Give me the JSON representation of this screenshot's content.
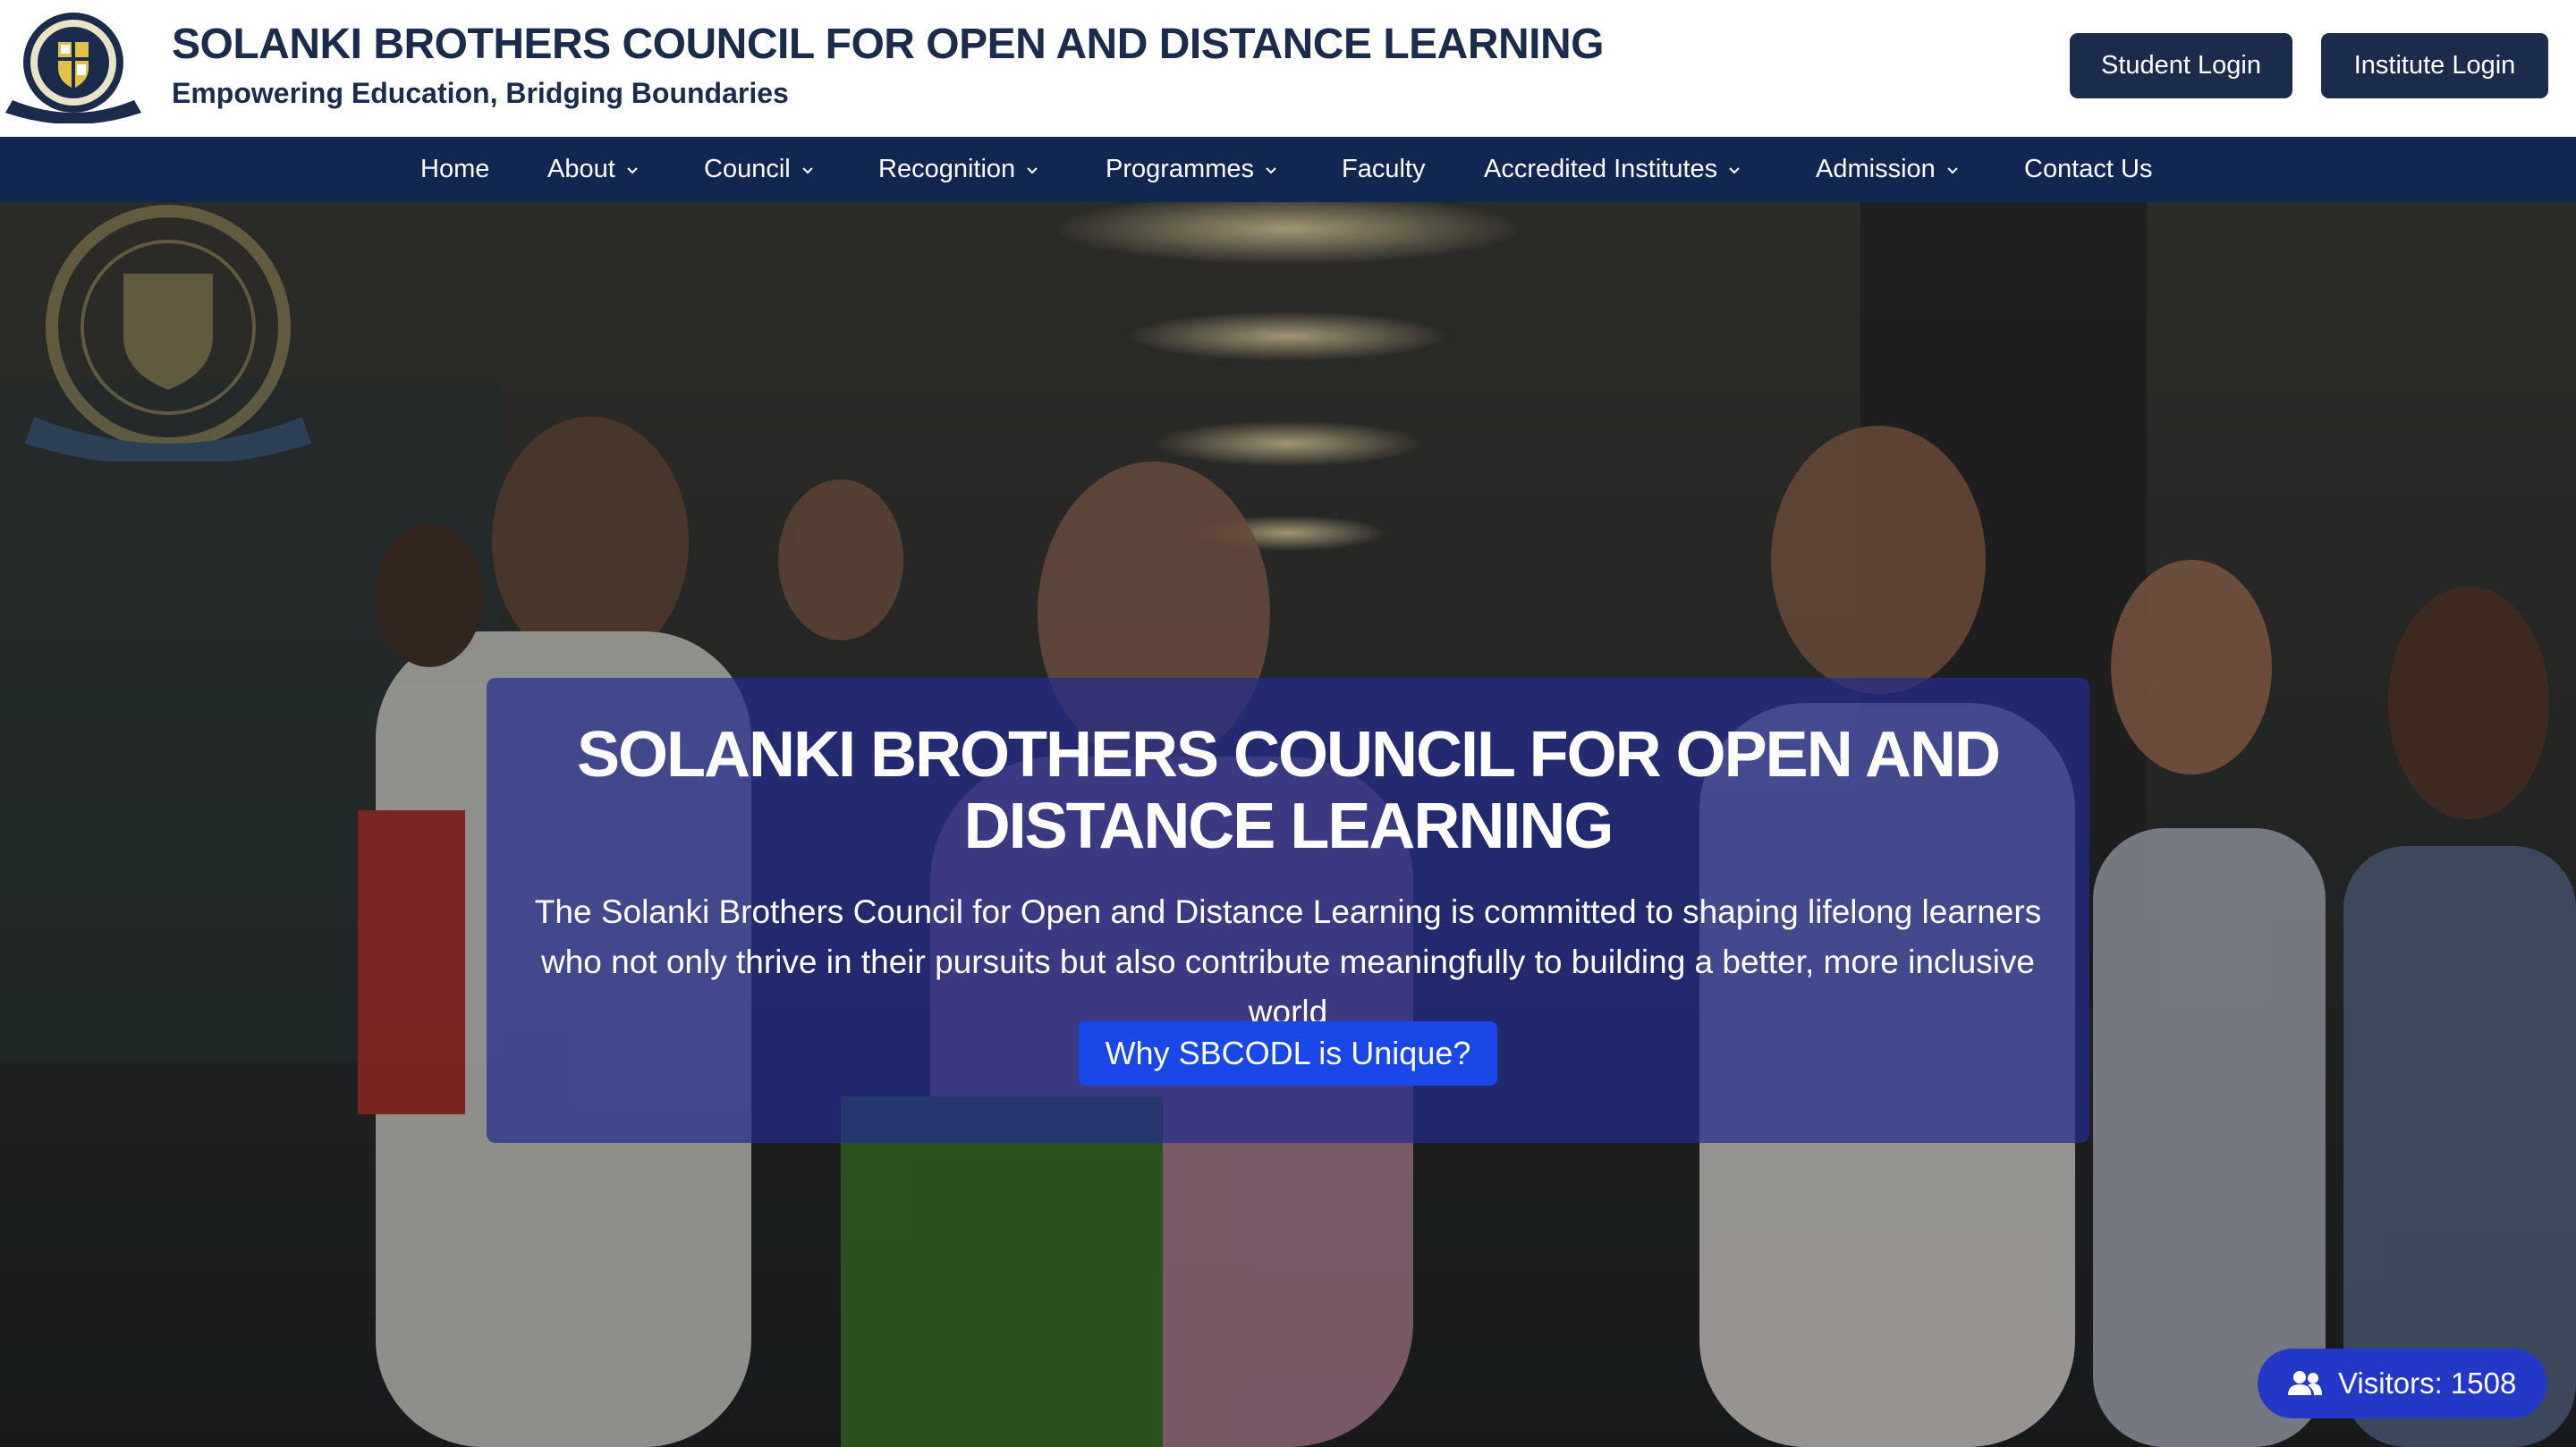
{
  "header": {
    "title": "SOLANKI BROTHERS COUNCIL FOR OPEN AND DISTANCE LEARNING",
    "tagline": "Empowering Education, Bridging Boundaries",
    "student_login": "Student Login",
    "institute_login": "Institute Login"
  },
  "nav": {
    "items": [
      {
        "label": "Home",
        "has_dropdown": false
      },
      {
        "label": "About",
        "has_dropdown": true
      },
      {
        "label": "Council",
        "has_dropdown": true
      },
      {
        "label": "Recognition",
        "has_dropdown": true
      },
      {
        "label": "Programmes",
        "has_dropdown": true
      },
      {
        "label": "Faculty",
        "has_dropdown": false
      },
      {
        "label": "Accredited Institutes",
        "has_dropdown": true
      },
      {
        "label": "Admission",
        "has_dropdown": true
      },
      {
        "label": "Contact Us",
        "has_dropdown": false
      }
    ]
  },
  "hero": {
    "title": "SOLANKI BROTHERS COUNCIL FOR OPEN AND DISTANCE LEARNING",
    "description": "The Solanki Brothers Council for Open and Distance Learning is committed to shaping lifelong learners who not only thrive in their pursuits but also contribute meaningfully to building a better, more inclusive world",
    "cta": "Why SBCODL is Unique?"
  },
  "visitors": {
    "label": "Visitors: 1508",
    "icon": "users-icon"
  },
  "colors": {
    "primary_dark": "#1b2b4b",
    "nav_bg": "#112650",
    "cta_blue": "#1a47e8",
    "badge_blue": "#2438c8"
  }
}
